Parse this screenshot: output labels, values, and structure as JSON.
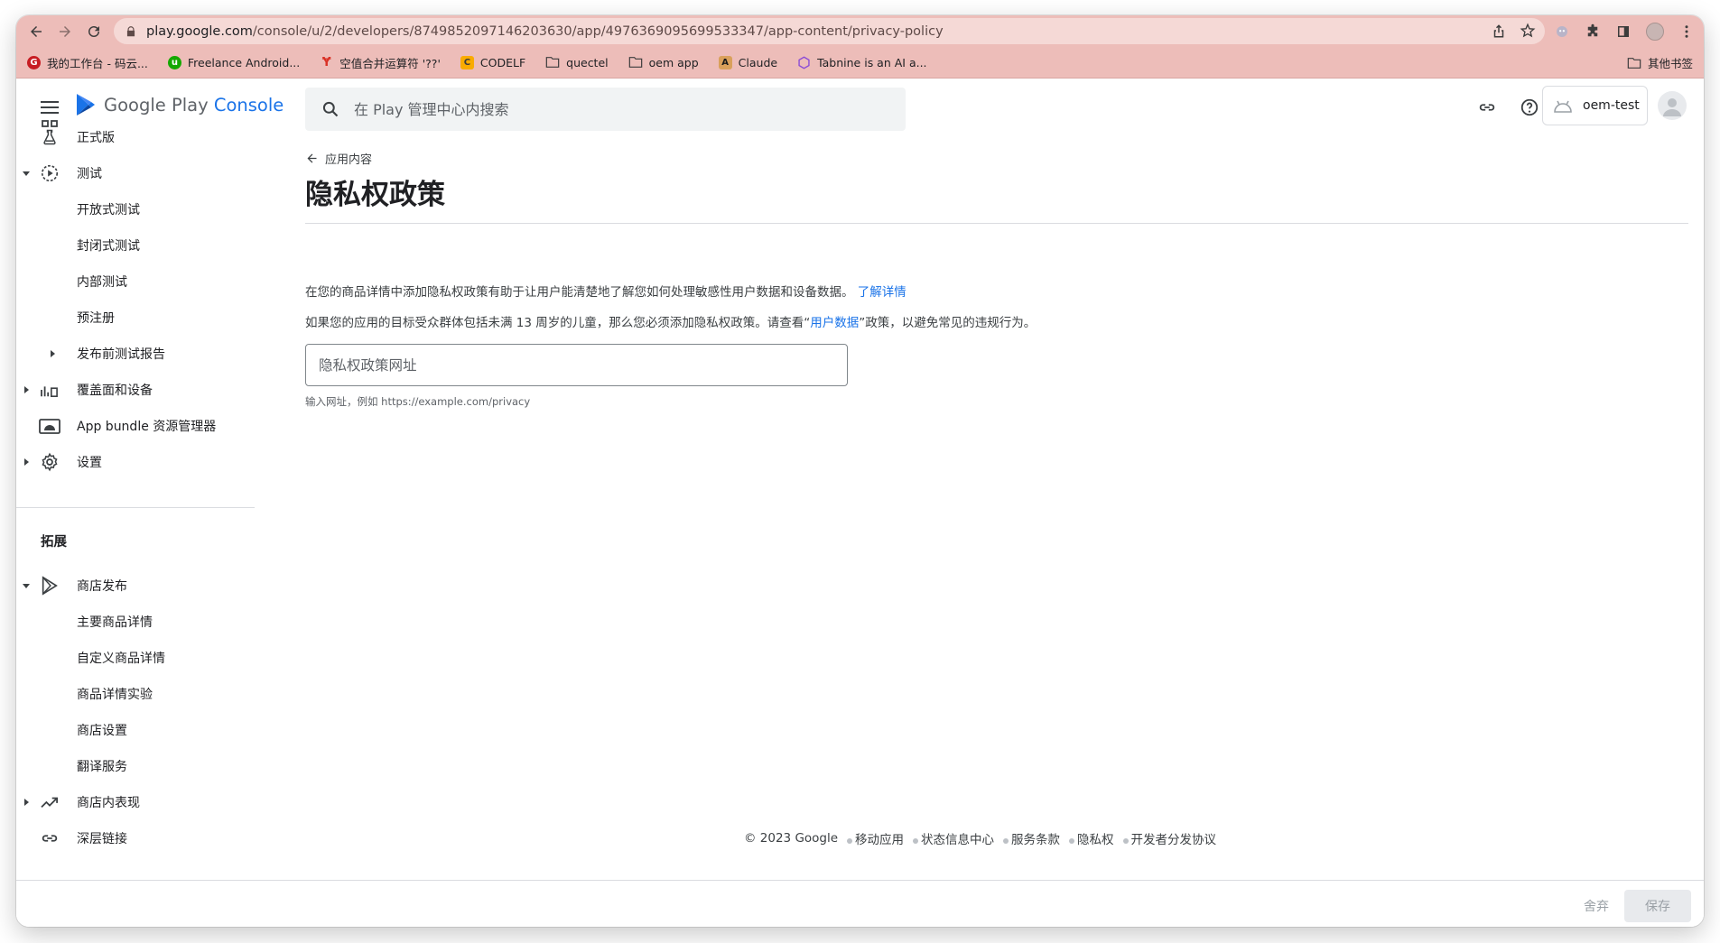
{
  "browser": {
    "url_host": "play.google.com",
    "url_path": "/console/u/2/developers/8749852097146203630/app/4976369095699533347/app-content/privacy-policy",
    "bookmarks": [
      {
        "label": "我的工作台 - 码云...",
        "icon": "gitee-icon",
        "color": "#c71d23"
      },
      {
        "label": "Freelance Android...",
        "icon": "upwork-icon",
        "color": "#14a800"
      },
      {
        "label": "空值合并运算符 '??'",
        "icon": "figure-icon",
        "color": "#d93025"
      },
      {
        "label": "CODELF",
        "icon": "codelf-icon",
        "color": "#f9ab00"
      },
      {
        "label": "quectel",
        "icon": "folder-icon",
        "color": ""
      },
      {
        "label": "oem app",
        "icon": "folder-icon",
        "color": ""
      },
      {
        "label": "Claude",
        "icon": "anthropic-icon",
        "color": "#7a5a2a"
      },
      {
        "label": "Tabnine is an AI a...",
        "icon": "tabnine-icon",
        "color": "#8a4bd6"
      }
    ],
    "other_bookmarks": "其他书签"
  },
  "header": {
    "logo_text": "Google Play",
    "logo_console": "Console",
    "search_placeholder": "在 Play 管理中心内搜索",
    "account_name": "oem-test"
  },
  "sidebar": {
    "items": [
      {
        "label": "正式版",
        "icon": "flask-icon",
        "arrow": ""
      },
      {
        "label": "测试",
        "icon": "play-circle-icon",
        "arrow": "down"
      },
      {
        "label": "开放式测试",
        "icon": "",
        "arrow": ""
      },
      {
        "label": "封闭式测试",
        "icon": "",
        "arrow": ""
      },
      {
        "label": "内部测试",
        "icon": "",
        "arrow": ""
      },
      {
        "label": "预注册",
        "icon": "",
        "arrow": ""
      },
      {
        "label": "发布前测试报告",
        "icon": "",
        "arrow": "right"
      },
      {
        "label": "覆盖面和设备",
        "icon": "bar-chart-icon",
        "arrow": "right"
      },
      {
        "label": "App bundle 资源管理器",
        "icon": "android-bundle-icon",
        "arrow": ""
      },
      {
        "label": "设置",
        "icon": "gear-icon",
        "arrow": "right"
      }
    ],
    "section_title": "拓展",
    "section_items": [
      {
        "label": "商店发布",
        "icon": "play-outline-icon",
        "arrow": "down"
      },
      {
        "label": "主要商品详情",
        "icon": "",
        "arrow": ""
      },
      {
        "label": "自定义商品详情",
        "icon": "",
        "arrow": ""
      },
      {
        "label": "商品详情实验",
        "icon": "",
        "arrow": ""
      },
      {
        "label": "商店设置",
        "icon": "",
        "arrow": ""
      },
      {
        "label": "翻译服务",
        "icon": "",
        "arrow": ""
      },
      {
        "label": "商店内表现",
        "icon": "trending-icon",
        "arrow": "right"
      },
      {
        "label": "深层链接",
        "icon": "link-icon",
        "arrow": ""
      }
    ]
  },
  "main": {
    "back_label": "应用内容",
    "title": "隐私权政策",
    "desc1": "在您的商品详情中添加隐私权政策有助于让用户能清楚地了解您如何处理敏感性用户数据和设备数据。",
    "desc1_link": "了解详情",
    "desc2_before": "如果您的应用的目标受众群体包括未满 13 周岁的儿童，那么您必须添加隐私权政策。请查看“",
    "desc2_link": "用户数据",
    "desc2_after": "”政策，以避免常见的违规行为。",
    "url_placeholder": "隐私权政策网址",
    "url_value": "",
    "helper_text": "输入网址，例如 https://example.com/privacy"
  },
  "footer": {
    "copyright": "© 2023 Google",
    "links": [
      "移动应用",
      "状态信息中心",
      "服务条款",
      "隐私权",
      "开发者分发协议"
    ]
  },
  "actions": {
    "discard_label": "舍弃",
    "save_label": "保存"
  },
  "colors": {
    "accent": "#1a73e8",
    "browser_chrome": "#edbdb9"
  }
}
